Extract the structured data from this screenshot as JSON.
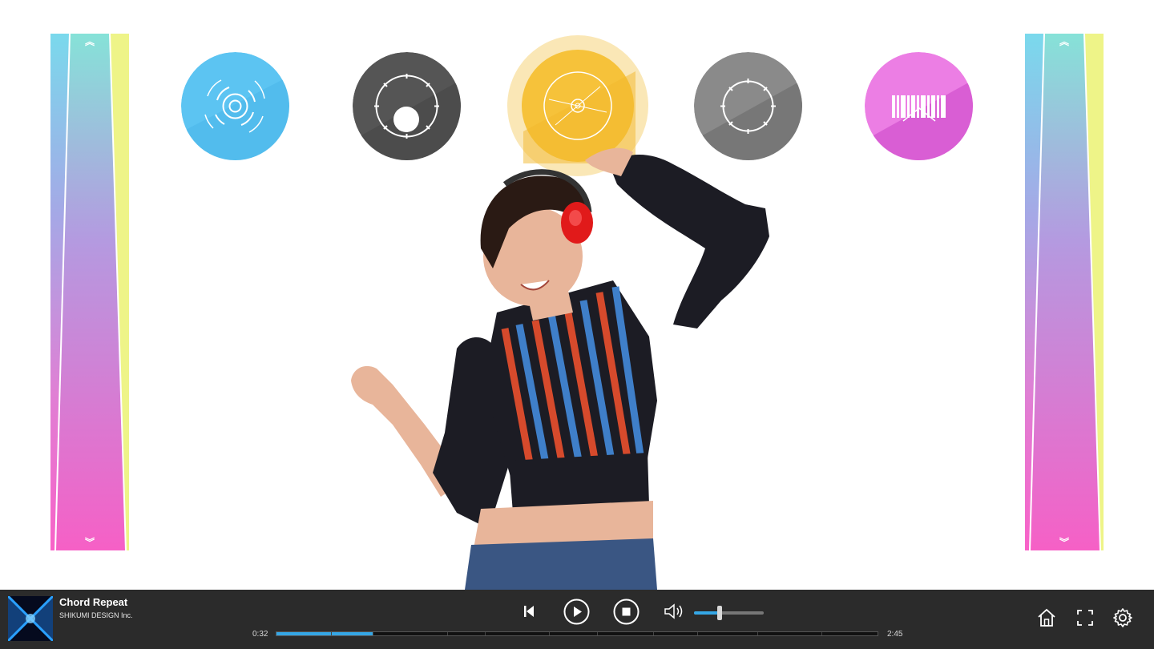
{
  "track": {
    "title": "Chord Repeat",
    "artist": "SHIKUMI DESIGN Inc.",
    "current_time": "0:32",
    "total_time": "2:45",
    "progress_fraction": 0.16
  },
  "volume": {
    "level_fraction": 0.37
  },
  "side_sliders": {
    "up_glyph": "︽",
    "down_glyph": "︾"
  },
  "pads": [
    {
      "name": "pad-1",
      "icon": "ripple-rings-icon",
      "color": "#5cc4f2"
    },
    {
      "name": "pad-2",
      "icon": "drum-with-dot-icon",
      "color": "#4d4d4d"
    },
    {
      "name": "pad-3",
      "icon": "cymbal-icon",
      "color": "#f6c23a"
    },
    {
      "name": "pad-4",
      "icon": "drum-icon",
      "color": "#7a7a7a"
    },
    {
      "name": "pad-5",
      "icon": "keyboard-icon",
      "color": "#e064d8"
    }
  ],
  "controls": {
    "previous": "previous-track-icon",
    "play": "play-icon",
    "stop": "stop-icon",
    "volume": "speaker-icon",
    "home": "home-icon",
    "fullscreen": "fullscreen-icon",
    "settings": "gear-icon"
  },
  "colors": {
    "accent": "#35a7e6",
    "player_bg": "#2b2b2b",
    "gradient_top": "#7fd8ec",
    "gradient_bottom": "#f863c8",
    "edge_yellow": "#eef488"
  }
}
